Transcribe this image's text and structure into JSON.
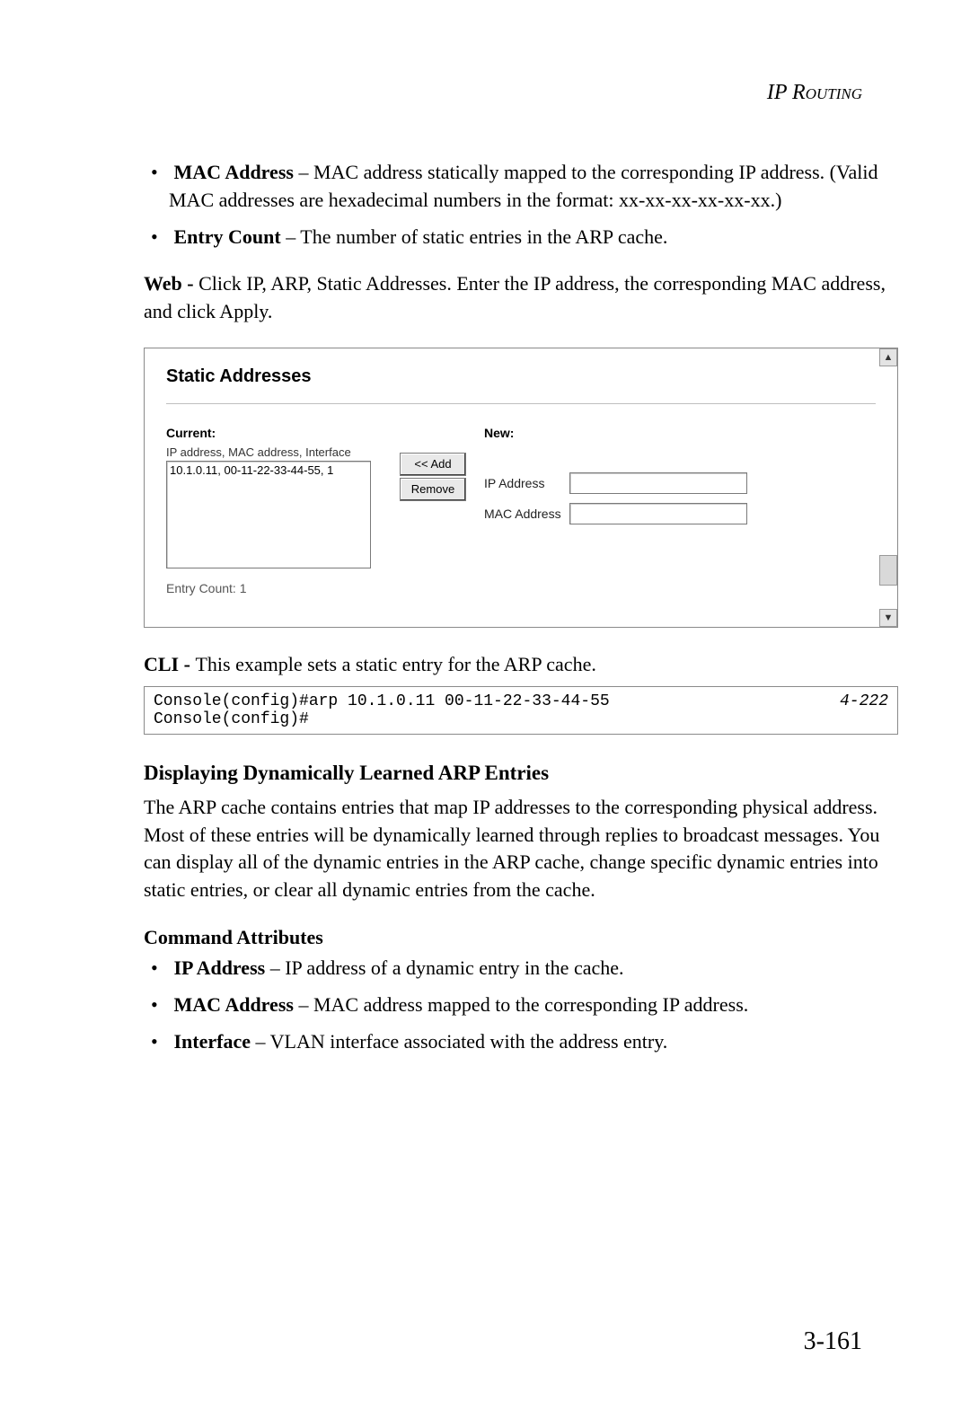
{
  "header": {
    "title": "IP Routing"
  },
  "bullets_top": [
    {
      "label": "MAC Address",
      "text": " – MAC address statically mapped to the corresponding IP address. (Valid MAC addresses are hexadecimal numbers in the format: xx-xx-xx-xx-xx-xx.)"
    },
    {
      "label": "Entry Count",
      "text": " – The number of static entries in the ARP cache."
    }
  ],
  "web_para": {
    "lead": "Web - ",
    "body": "Click IP, ARP, Static Addresses. Enter the IP address, the corresponding MAC address, and click Apply."
  },
  "ui": {
    "title": "Static Addresses",
    "current_label": "Current:",
    "current_caption": "IP address, MAC address, Interface",
    "listbox_item": "10.1.0.11, 00-11-22-33-44-55, 1",
    "add_btn": "<< Add",
    "remove_btn": "Remove",
    "new_label": "New:",
    "ip_label": "IP Address",
    "mac_label": "MAC Address",
    "ip_value": "",
    "mac_value": "",
    "entry_count": "Entry Count: 1"
  },
  "cli_para": {
    "lead": "CLI - ",
    "body": "This example sets a static entry for the ARP cache."
  },
  "cli": {
    "lines": "Console(config)#arp 10.1.0.11 00-11-22-33-44-55\nConsole(config)#",
    "ref": "4-222"
  },
  "section_heading": "Displaying Dynamically Learned ARP Entries",
  "section_body": "The ARP cache contains entries that map IP addresses to the corresponding physical address. Most of these entries will be dynamically learned through replies to broadcast messages. You can display all of the dynamic entries in the ARP cache, change specific dynamic entries into static entries, or clear all dynamic entries from the cache.",
  "cmd_attr_heading": "Command Attributes",
  "cmd_attrs": [
    {
      "label": "IP Address",
      "text": " – IP address of a dynamic entry in the cache."
    },
    {
      "label": "MAC Address",
      "text": " – MAC address mapped to the corresponding IP address."
    },
    {
      "label": "Interface",
      "text": " – VLAN interface associated with the address entry."
    }
  ],
  "page_number": "3-161"
}
